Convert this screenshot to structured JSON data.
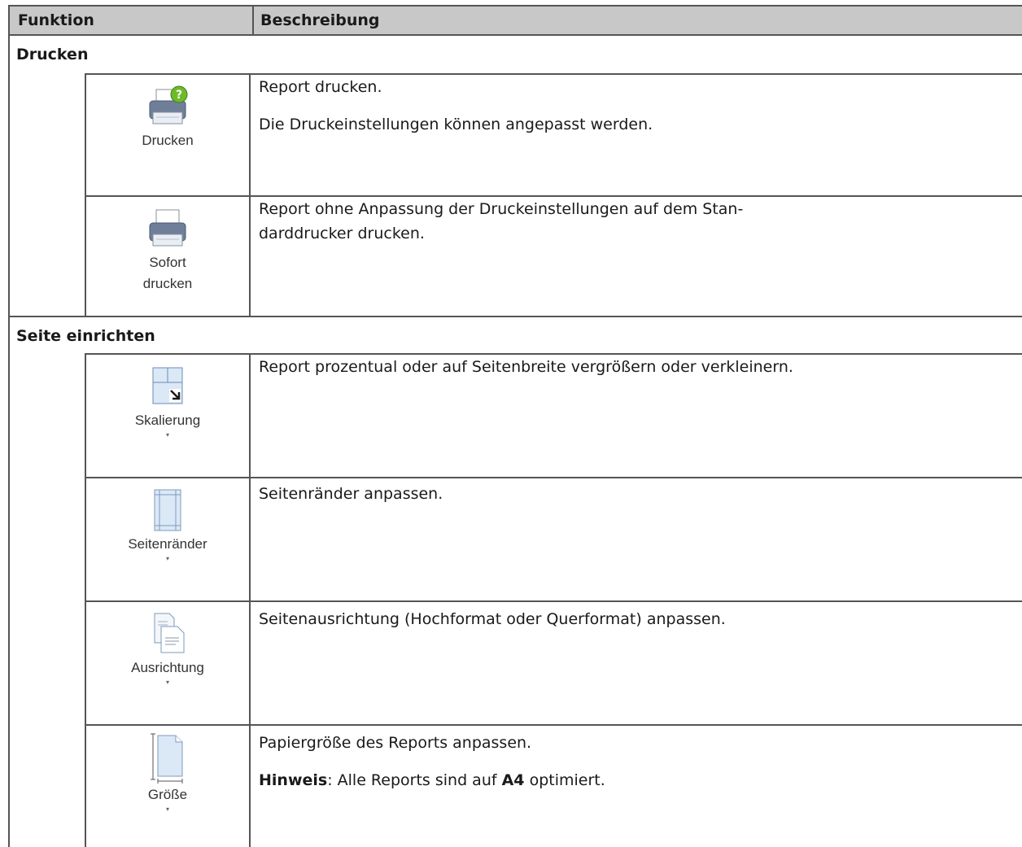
{
  "header": {
    "col1": "Funktion",
    "col2": "Beschreibung"
  },
  "sections": [
    {
      "title": "Drucken"
    },
    {
      "title": "Seite einrichten"
    }
  ],
  "rows": [
    {
      "icon": "printer-help-icon",
      "label": "Drucken",
      "desc1": "Report drucken.",
      "desc2": "Die Druckeinstellungen können angepasst werden."
    },
    {
      "icon": "printer-icon",
      "label_line1": "Sofort",
      "label_line2": "drucken",
      "desc1": "Report ohne Anpassung der Druckeinstellungen auf dem Stan-",
      "desc1b": "darddrucker drucken."
    },
    {
      "icon": "scale-icon",
      "label": "Skalierung",
      "desc1": "Report prozentual oder auf Seitenbreite vergrößern oder verkleinern."
    },
    {
      "icon": "margins-icon",
      "label": "Seitenränder",
      "desc1": "Seitenränder anpassen."
    },
    {
      "icon": "orientation-icon",
      "label": "Ausrichtung",
      "desc1": "Seitenausrichtung (Hochformat oder Querformat) anpassen."
    },
    {
      "icon": "page-size-icon",
      "label": "Größe",
      "desc1": "Papiergröße des Reports anpassen.",
      "note_label": "Hinweis",
      "note_text1": ": Alle Reports sind auf ",
      "note_bold": "A4",
      "note_text2": " optimiert."
    }
  ],
  "dropdown_arrow": "▾"
}
